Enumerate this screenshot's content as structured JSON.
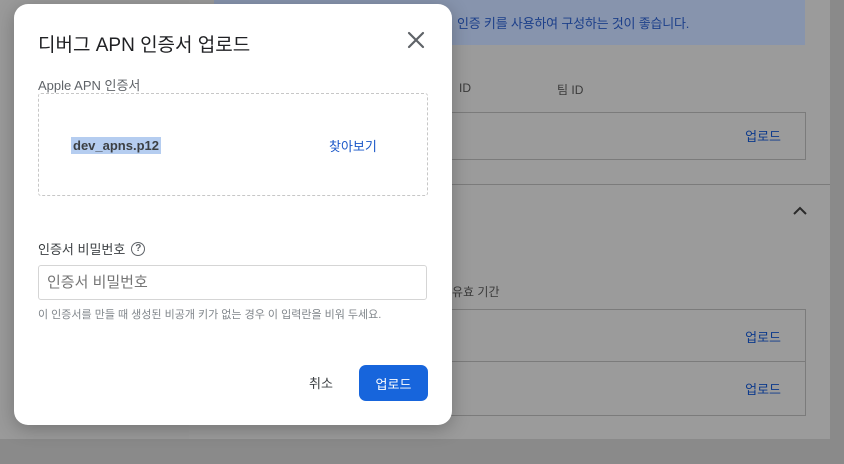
{
  "background": {
    "banner_text": "인증 키를 사용하여 구성하는 것이 좋습니다.",
    "col_key_id": "ID",
    "col_team_id": "팀 ID",
    "upload_label": "업로드",
    "expiry_label": "유효 기간",
    "chevron": "^"
  },
  "dialog": {
    "title": "디버그 APN 인증서 업로드",
    "certificate_label": "Apple APN 인증서",
    "file_name": "dev_apns.p12",
    "browse_label": "찾아보기",
    "password_label": "인증서 비밀번호",
    "help_glyph": "?",
    "password_placeholder": "인증서 비밀번호",
    "password_value": "",
    "hint": "이 인증서를 만들 때 생성된 비공개 키가 없는 경우 이 입력란을 비워 두세요.",
    "cancel_label": "취소",
    "upload_label": "업로드"
  },
  "colors": {
    "primary": "#1765dc",
    "link": "#1a57c8",
    "overlay": "#8a8a8a"
  },
  "icons": {
    "close": "close-icon",
    "help": "help-icon"
  }
}
